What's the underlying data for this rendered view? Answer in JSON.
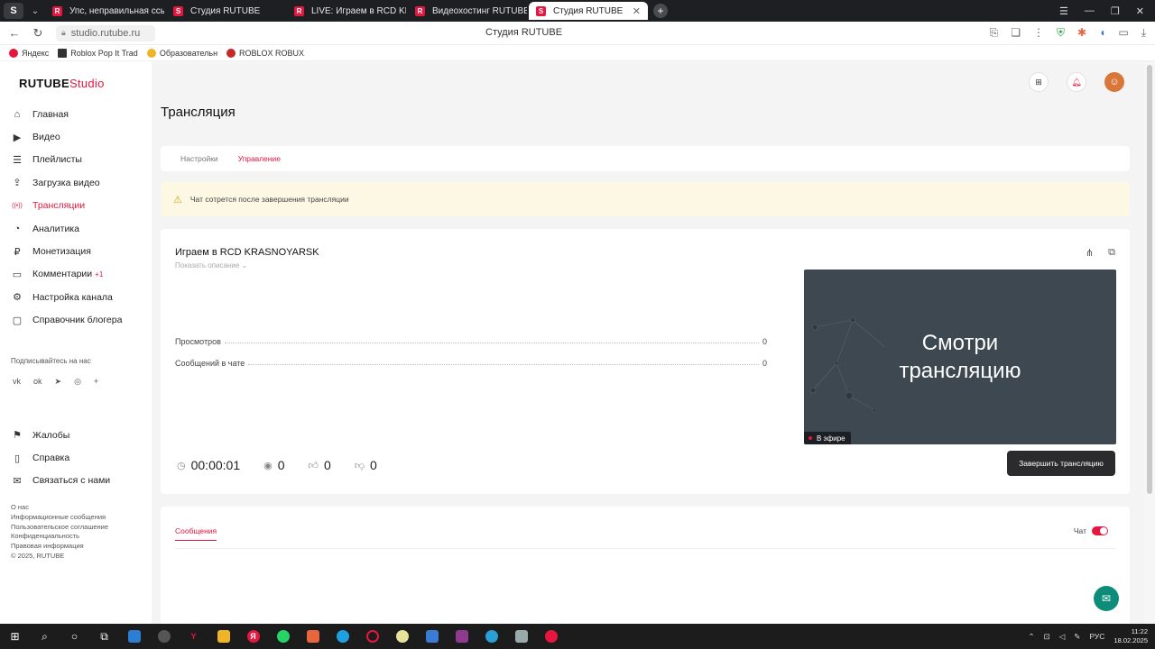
{
  "browser": {
    "brand": "S",
    "tabs": [
      {
        "label": "Упс, неправильная ссылка",
        "fav": "R"
      },
      {
        "label": "Студия RUTUBE",
        "fav": "S"
      },
      {
        "label": "LIVE: Играем в RCD KRAS",
        "fav": "R"
      },
      {
        "label": "Видеохостинг RUTUBE. С",
        "fav": "R"
      },
      {
        "label": "Студия RUTUBE",
        "fav": "S"
      }
    ],
    "url": "studio.rutube.ru",
    "page_title": "Студия RUTUBE",
    "bookmarks": [
      "Яндекс",
      "Roblox Pop It Trad",
      "Образовательн",
      "ROBLOX ROBUX"
    ]
  },
  "sidebar": {
    "logo_main": "RUTUBE",
    "logo_studio": "Studio",
    "items": [
      {
        "label": "Главная",
        "icon": "⌂"
      },
      {
        "label": "Видео",
        "icon": "▶"
      },
      {
        "label": "Плейлисты",
        "icon": "☰"
      },
      {
        "label": "Загрузка видео",
        "icon": "⇪"
      },
      {
        "label": "Трансляции",
        "icon": "((•))"
      },
      {
        "label": "Аналитика",
        "icon": "◔"
      },
      {
        "label": "Монетизация",
        "icon": "₽"
      },
      {
        "label": "Комментарии",
        "icon": "▭",
        "badge": "+1"
      },
      {
        "label": "Настройка канала",
        "icon": "⚙"
      },
      {
        "label": "Справочник блогера",
        "icon": "▢"
      }
    ],
    "follow_label": "Подписывайтесь на нас",
    "socials": [
      "vk",
      "ok",
      "➤",
      "◎",
      "+"
    ],
    "items2": [
      {
        "label": "Жалобы",
        "icon": "⚑"
      },
      {
        "label": "Справка",
        "icon": "▯"
      },
      {
        "label": "Связаться с нами",
        "icon": "✉"
      }
    ],
    "footer_links": [
      "О нас",
      "Информационные сообщения",
      "Пользовательское соглашение",
      "Конфиденциальность",
      "Правовая информация",
      "© 2025, RUTUBE"
    ]
  },
  "main": {
    "title": "Трансляция",
    "tabs": [
      "Настройки",
      "Управление"
    ],
    "warning": "Чат сотрется после завершения трансляции",
    "stream": {
      "title": "Играем в RCD KRASNOYARSK",
      "desc_toggle": "Показать описание ⌄",
      "stats": [
        {
          "label": "Просмотров",
          "value": "0"
        },
        {
          "label": "Сообщений в чате",
          "value": "0"
        }
      ],
      "preview_text_1": "Смотри",
      "preview_text_2": "трансляцию",
      "live_label": "В эфире",
      "timer": "00:00:01",
      "viewers": "0",
      "likes": "0",
      "dislikes": "0",
      "end_button": "Завершить трансляцию"
    },
    "chat": {
      "tab": "Сообщения",
      "toggle_label": "Чат"
    }
  },
  "taskbar": {
    "time": "11:22",
    "date": "18.02.2025",
    "lang": "РУС"
  }
}
